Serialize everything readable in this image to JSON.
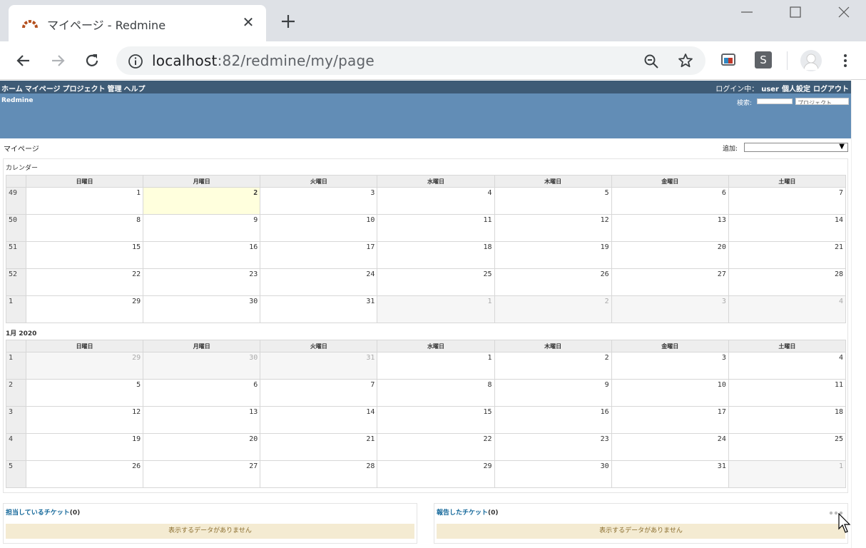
{
  "browser": {
    "tab_title": "マイページ - Redmine",
    "tab_close": "✕",
    "url_host": "localhost",
    "url_path": ":82/redmine/my/page",
    "ext2_letter": "S"
  },
  "top_menu": {
    "items": [
      "ホーム",
      "マイページ",
      "プロジェクト",
      "管理",
      "ヘルプ"
    ],
    "logged_in_label": "ログイン中：",
    "user": "user",
    "my_account": "個人設定",
    "logout": "ログアウト"
  },
  "header": {
    "site_title": "Redmine",
    "search_label": "検索:",
    "project_select": "プロジェクト"
  },
  "page": {
    "title": "マイページ",
    "add_label": "追加:"
  },
  "calendar": {
    "title": "カレンダー",
    "weekdays": [
      "日曜日",
      "月曜日",
      "火曜日",
      "水曜日",
      "木曜日",
      "金曜日",
      "土曜日"
    ],
    "december": {
      "weeks": [
        {
          "num": "49",
          "days": [
            "1",
            "2",
            "3",
            "4",
            "5",
            "6",
            "7"
          ]
        },
        {
          "num": "50",
          "days": [
            "8",
            "9",
            "10",
            "11",
            "12",
            "13",
            "14"
          ]
        },
        {
          "num": "51",
          "days": [
            "15",
            "16",
            "17",
            "18",
            "19",
            "20",
            "21"
          ]
        },
        {
          "num": "52",
          "days": [
            "22",
            "23",
            "24",
            "25",
            "26",
            "27",
            "28"
          ]
        },
        {
          "num": "1",
          "days": [
            "29",
            "30",
            "31",
            "1",
            "2",
            "3",
            "4"
          ]
        }
      ]
    },
    "january_title": "1月 2020",
    "january": {
      "weeks": [
        {
          "num": "1",
          "days": [
            "29",
            "30",
            "31",
            "1",
            "2",
            "3",
            "4"
          ]
        },
        {
          "num": "2",
          "days": [
            "5",
            "6",
            "7",
            "8",
            "9",
            "10",
            "11"
          ]
        },
        {
          "num": "3",
          "days": [
            "12",
            "13",
            "14",
            "15",
            "16",
            "17",
            "18"
          ]
        },
        {
          "num": "4",
          "days": [
            "19",
            "20",
            "21",
            "22",
            "23",
            "24",
            "25"
          ]
        },
        {
          "num": "5",
          "days": [
            "26",
            "27",
            "28",
            "29",
            "30",
            "31",
            "1"
          ]
        }
      ]
    }
  },
  "assigned": {
    "title": "担当しているチケット",
    "count": "(0)",
    "nodata": "表示するデータがありません"
  },
  "reported": {
    "title": "報告したチケット",
    "count": "(0)",
    "nodata": "表示するデータがありません"
  }
}
